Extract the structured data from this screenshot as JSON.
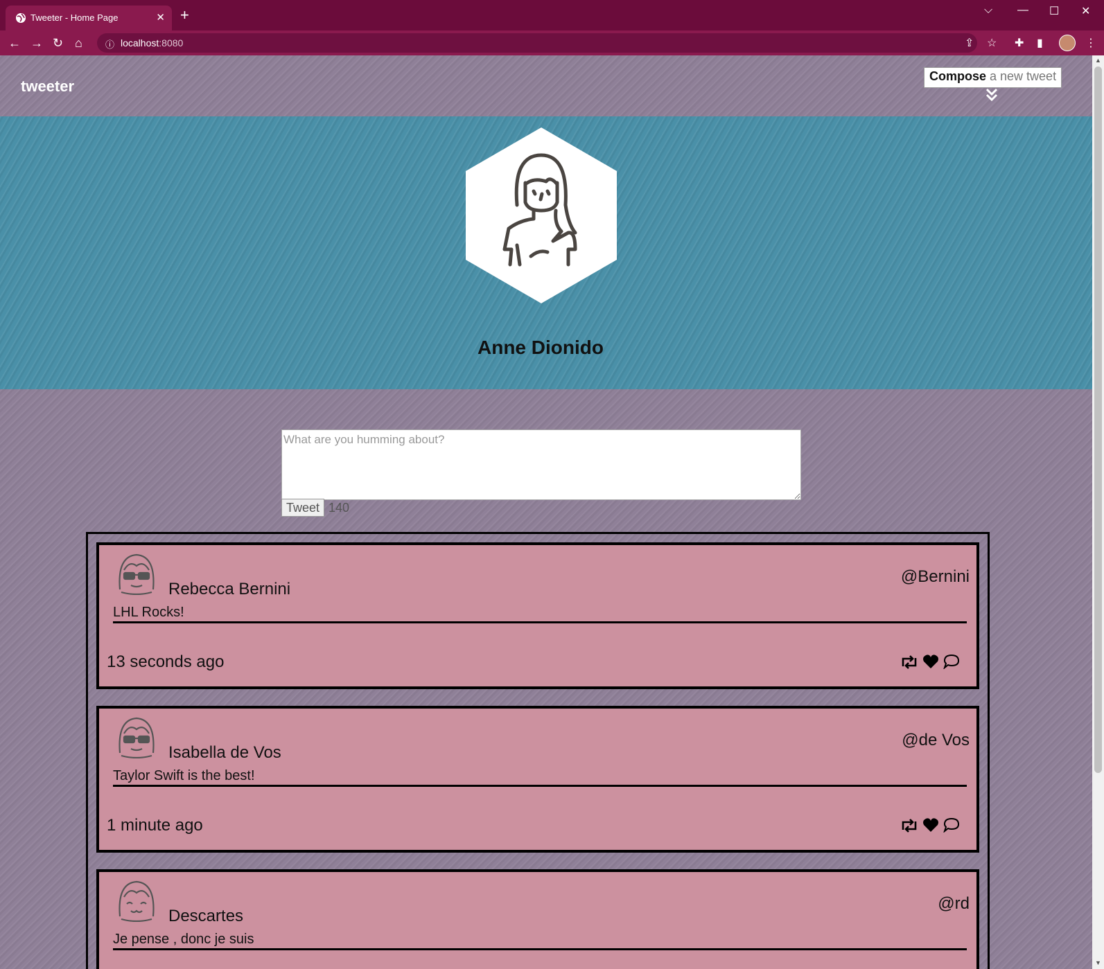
{
  "browser": {
    "tab_title": "Tweeter - Home Page",
    "close_tab": "✕",
    "new_tab": "+",
    "url_host": "localhost",
    "url_port": ":8080"
  },
  "navbar": {
    "brand": "tweeter",
    "compose_bold": "Compose",
    "compose_rest": " a new tweet"
  },
  "profile": {
    "name": "Anne Dionido"
  },
  "new_tweet": {
    "placeholder": "What are you humming about?",
    "button_label": "Tweet",
    "char_count": "140"
  },
  "tweets": [
    {
      "name": "Rebecca Bernini",
      "handle": "@Bernini",
      "content": "LHL Rocks!",
      "time": "13 seconds ago",
      "avatar": "sunglasses-girl-icon"
    },
    {
      "name": "Isabella de Vos",
      "handle": "@de Vos",
      "content": "Taylor Swift is the best!",
      "time": "1 minute ago",
      "avatar": "sunglasses-girl-icon"
    },
    {
      "name": "Descartes",
      "handle": "@rd",
      "content": "Je pense , donc je suis",
      "time": "",
      "avatar": "smiling-girl-icon"
    }
  ],
  "colors": {
    "page_bg": "#8f8098",
    "header_bg": "#4a90a8",
    "tweet_bg": "#cc919f",
    "browser_frame": "#6b0c3b"
  }
}
